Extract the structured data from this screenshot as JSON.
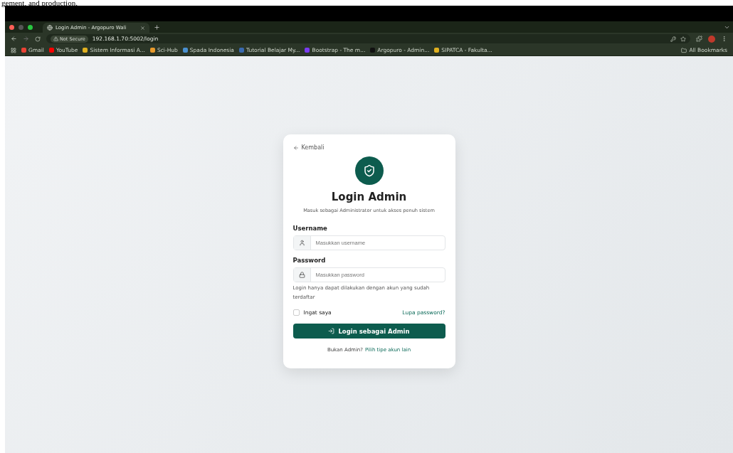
{
  "document_text": "gement, and production.",
  "browser": {
    "tabs": [
      {
        "title": "Login Admin - Argopuro Wali",
        "selected": true
      }
    ],
    "security_label": "Not Secure",
    "url": "192.168.1.70:5002/login",
    "bookmarks": [
      {
        "label": "Gmail",
        "color": "#ea4335"
      },
      {
        "label": "YouTube",
        "color": "#ff0000"
      },
      {
        "label": "Sistem Informasi A...",
        "color": "#e0b020"
      },
      {
        "label": "Sci-Hub",
        "color": "#e89a2c"
      },
      {
        "label": "Spada Indonesia",
        "color": "#4a90d0"
      },
      {
        "label": "Tutorial Belajar My...",
        "color": "#3a6ab0"
      },
      {
        "label": "Bootstrap - The m...",
        "color": "#7a3cf0"
      },
      {
        "label": "Argopuro - Admin...",
        "color": "#111111"
      },
      {
        "label": "SIPATCA - Fakulta...",
        "color": "#e0b020"
      }
    ],
    "all_bookmarks": "All Bookmarks"
  },
  "card": {
    "back": "Kembali",
    "title": "Login Admin",
    "subtitle": "Masuk sebagai Administrator untuk akses penuh sistem",
    "fields": [
      {
        "kind": "user",
        "label": "Username",
        "placeholder": "Masukkan username"
      },
      {
        "kind": "lock",
        "label": "Password",
        "placeholder": "Masukkan password"
      }
    ],
    "note": "Login hanya dapat dilakukan dengan akun yang sudah terdaftar",
    "remember": {
      "label": "Ingat saya",
      "checked": false
    },
    "forgot": "Lupa password?",
    "submit": "Login sebagai Admin",
    "footer_text": "Bukan Admin?",
    "footer_link": "Pilih tipe akun lain"
  }
}
